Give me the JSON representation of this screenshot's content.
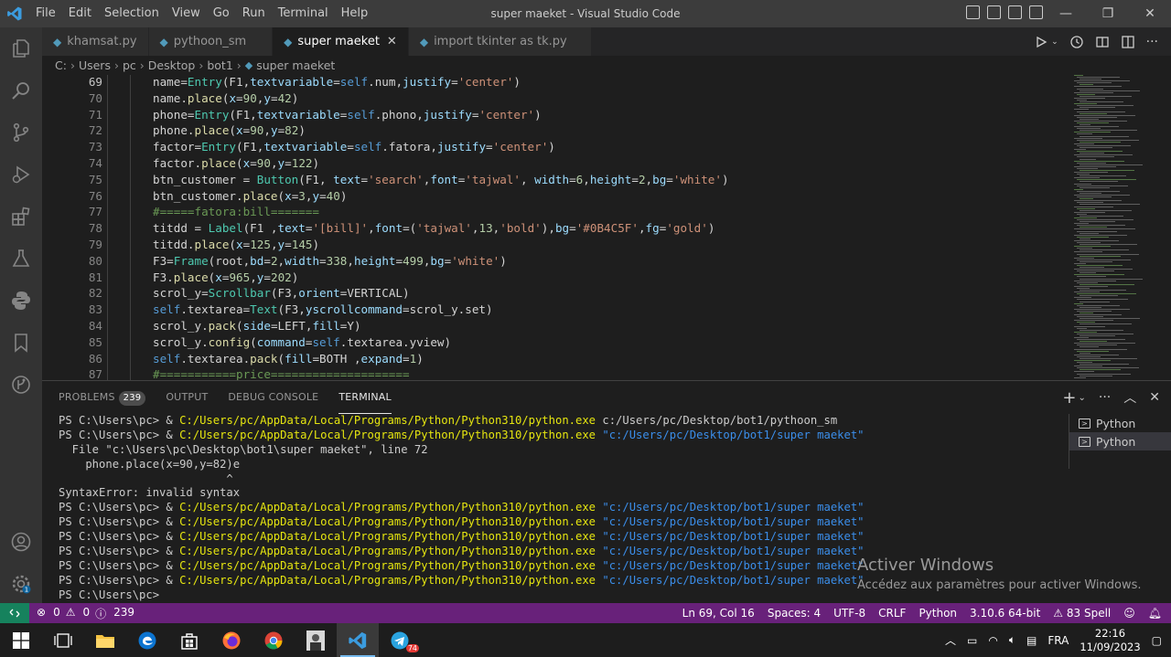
{
  "window": {
    "title": "super maeket - Visual Studio Code",
    "menus": [
      "File",
      "Edit",
      "Selection",
      "View",
      "Go",
      "Run",
      "Terminal",
      "Help"
    ]
  },
  "tabs": [
    {
      "label": "khamsat.py",
      "active": false
    },
    {
      "label": "pythoon_sm",
      "active": false
    },
    {
      "label": "super maeket",
      "active": true
    },
    {
      "label": "import tkinter as tk.py",
      "active": false
    }
  ],
  "breadcrumb": [
    "C:",
    "Users",
    "pc",
    "Desktop",
    "bot1",
    "super maeket"
  ],
  "editor": {
    "lines": [
      {
        "num": "69",
        "text": "name=Entry(F1,textvariable=self.num,justify='center')"
      },
      {
        "num": "70",
        "text": "name.place(x=90,y=42)"
      },
      {
        "num": "71",
        "text": "phone=Entry(F1,textvariable=self.phono,justify='center')"
      },
      {
        "num": "72",
        "text": "phone.place(x=90,y=82)"
      },
      {
        "num": "73",
        "text": "factor=Entry(F1,textvariable=self.fatora,justify='center')"
      },
      {
        "num": "74",
        "text": "factor.place(x=90,y=122)"
      },
      {
        "num": "75",
        "text": "btn_customer = Button(F1, text='search',font='tajwal', width=6,height=2,bg='white')"
      },
      {
        "num": "76",
        "text": "btn_customer.place(x=3,y=40)"
      },
      {
        "num": "77",
        "text": "#=====fatora:bill======="
      },
      {
        "num": "78",
        "text": "titdd = Label(F1 ,text='[bill]',font=('tajwal',13,'bold'),bg='#0B4C5F',fg='gold')"
      },
      {
        "num": "79",
        "text": "titdd.place(x=125,y=145)"
      },
      {
        "num": "80",
        "text": "F3=Frame(root,bd=2,width=338,height=499,bg='white')"
      },
      {
        "num": "81",
        "text": "F3.place(x=965,y=202)"
      },
      {
        "num": "82",
        "text": "scrol_y=Scrollbar(F3,orient=VERTICAL)"
      },
      {
        "num": "83",
        "text": "self.textarea=Text(F3,yscrollcommand=scrol_y.set)"
      },
      {
        "num": "84",
        "text": "scrol_y.pack(side=LEFT,fill=Y)"
      },
      {
        "num": "85",
        "text": "scrol_y.config(command=self.textarea.yview)"
      },
      {
        "num": "86",
        "text": "self.textarea.pack(fill=BOTH ,expand=1)"
      },
      {
        "num": "87",
        "text": "#===========price===================="
      }
    ]
  },
  "panel": {
    "tabs": {
      "problems": "PROBLEMS",
      "problems_count": "239",
      "output": "OUTPUT",
      "debug": "DEBUG CONSOLE",
      "terminal": "TERMINAL"
    },
    "terminals": [
      "Python",
      "Python"
    ],
    "lines": [
      {
        "prompt": "PS C:\\Users\\pc> & ",
        "exe": "C:/Users/pc/AppData/Local/Programs/Python/Python310/python.exe",
        "arg": " c:/Users/pc/Desktop/bot1/pythoon_sm",
        "arg_quoted": false
      },
      {
        "prompt": "PS C:\\Users\\pc> & ",
        "exe": "C:/Users/pc/AppData/Local/Programs/Python/Python310/python.exe",
        "arg": " \"c:/Users/pc/Desktop/bot1/super maeket\"",
        "arg_quoted": true
      },
      {
        "plain": "  File \"c:\\Users\\pc\\Desktop\\bot1\\super maeket\", line 72"
      },
      {
        "plain": "    phone.place(x=90,y=82)e"
      },
      {
        "plain": "                         ^"
      },
      {
        "plain": "SyntaxError: invalid syntax"
      },
      {
        "prompt": "PS C:\\Users\\pc> & ",
        "exe": "C:/Users/pc/AppData/Local/Programs/Python/Python310/python.exe",
        "arg": " \"c:/Users/pc/Desktop/bot1/super maeket\"",
        "arg_quoted": true
      },
      {
        "prompt": "PS C:\\Users\\pc> & ",
        "exe": "C:/Users/pc/AppData/Local/Programs/Python/Python310/python.exe",
        "arg": " \"c:/Users/pc/Desktop/bot1/super maeket\"",
        "arg_quoted": true
      },
      {
        "prompt": "PS C:\\Users\\pc> & ",
        "exe": "C:/Users/pc/AppData/Local/Programs/Python/Python310/python.exe",
        "arg": " \"c:/Users/pc/Desktop/bot1/super maeket\"",
        "arg_quoted": true
      },
      {
        "prompt": "PS C:\\Users\\pc> & ",
        "exe": "C:/Users/pc/AppData/Local/Programs/Python/Python310/python.exe",
        "arg": " \"c:/Users/pc/Desktop/bot1/super maeket\"",
        "arg_quoted": true
      },
      {
        "prompt": "PS C:\\Users\\pc> & ",
        "exe": "C:/Users/pc/AppData/Local/Programs/Python/Python310/python.exe",
        "arg": " \"c:/Users/pc/Desktop/bot1/super maeket\"",
        "arg_quoted": true
      },
      {
        "prompt": "PS C:\\Users\\pc> & ",
        "exe": "C:/Users/pc/AppData/Local/Programs/Python/Python310/python.exe",
        "arg": " \"c:/Users/pc/Desktop/bot1/super maeket\"",
        "arg_quoted": true
      },
      {
        "plain": "PS C:\\Users\\pc>"
      }
    ]
  },
  "activation": {
    "title": "Activer Windows",
    "subtitle": "Accédez aux paramètres pour activer Windows."
  },
  "statusbar": {
    "errors": "0",
    "warnings": "0",
    "info": "239",
    "position": "Ln 69, Col 16",
    "spaces": "Spaces: 4",
    "encoding": "UTF-8",
    "eol": "CRLF",
    "language": "Python",
    "interpreter": "3.10.6 64-bit",
    "spell": "83 Spell"
  },
  "taskbar": {
    "language": "FRA",
    "time": "22:16",
    "date": "11/09/2023",
    "badge": "74"
  },
  "colors": {
    "accent": "#007acc",
    "statusbar": "#68217a",
    "remote": "#16825d"
  }
}
